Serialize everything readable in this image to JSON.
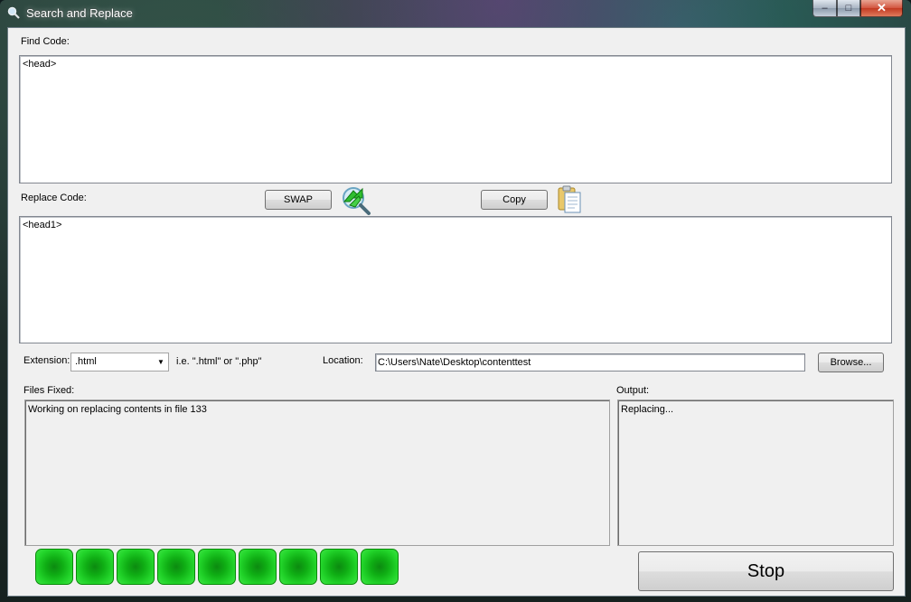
{
  "window": {
    "title": "Search and Replace",
    "minimize_glyph": "–",
    "maximize_glyph": "□",
    "close_glyph": "✕",
    "icon": "magnifier-icon"
  },
  "find": {
    "label": "Find Code:",
    "value": "<head>"
  },
  "replace": {
    "label": "Replace Code:",
    "value": "<head1>",
    "swap_label": "SWAP",
    "swap_icon": "swap-arrows-magnifier-icon",
    "copy_label": "Copy",
    "copy_icon": "clipboard-icon"
  },
  "extension": {
    "label": "Extension:",
    "value": ".html",
    "hint": "i.e.  \".html\" or \".php\""
  },
  "location": {
    "label": "Location:",
    "value": "C:\\Users\\Nate\\Desktop\\contenttest",
    "browse_label": "Browse..."
  },
  "files_fixed": {
    "label": "Files Fixed:",
    "text": "Working on replacing contents in file 133"
  },
  "output": {
    "label": "Output:",
    "text": "Replacing..."
  },
  "progress": {
    "filled_blocks": 9,
    "color": "#22d42a"
  },
  "stop_label": "Stop"
}
